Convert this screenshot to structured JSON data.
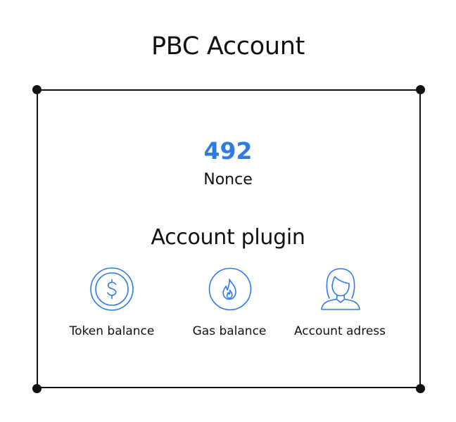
{
  "diagram": {
    "title": "PBC Account",
    "nonce": {
      "value": "492",
      "label": "Nonce"
    },
    "plugin": {
      "title": "Account plugin",
      "items": [
        {
          "label": "Token balance",
          "icon": "dollar-coin-icon"
        },
        {
          "label": "Gas balance",
          "icon": "flame-icon"
        },
        {
          "label": "Account adress",
          "icon": "person-icon"
        }
      ]
    }
  },
  "colors": {
    "accent": "#2f7ae5",
    "line": "#111111",
    "text": "#111111"
  }
}
